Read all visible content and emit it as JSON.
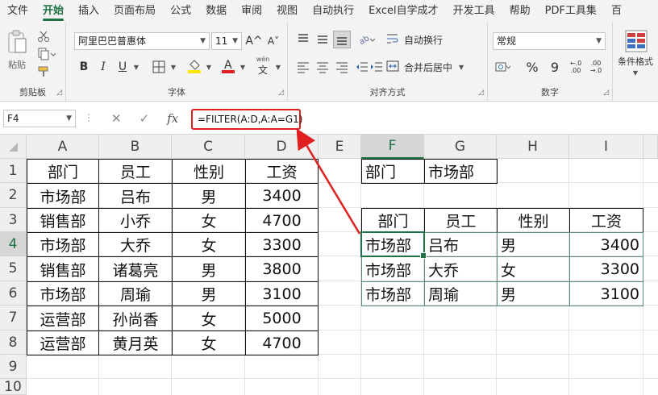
{
  "menu": {
    "tabs": [
      "文件",
      "开始",
      "插入",
      "页面布局",
      "公式",
      "数据",
      "审阅",
      "视图",
      "自动执行",
      "Excel自学成才",
      "开发工具",
      "帮助",
      "PDF工具集",
      "百"
    ],
    "active": "开始"
  },
  "ribbon": {
    "clipboard": {
      "label": "剪贴板",
      "paste": "粘贴"
    },
    "font": {
      "label": "字体",
      "name": "阿里巴巴普惠体",
      "size": "11",
      "grow": "A^",
      "shrink": "A˅",
      "bold": "B",
      "italic": "I",
      "underline": "U",
      "phonetic_top": "wén",
      "phonetic_bottom": "文"
    },
    "alignment": {
      "label": "对齐方式",
      "wrap": "自动换行",
      "merge": "合并后居中"
    },
    "number": {
      "label": "数字",
      "format": "常规",
      "percent": "%",
      "comma": "9",
      "inc": "←.0 .00",
      "dec": ".00 →.0"
    },
    "styles": {
      "conditional": "条件格式"
    }
  },
  "formula_bar": {
    "name_box": "F4",
    "formula": "=FILTER(A:D,A:A=G1)"
  },
  "columns": [
    "A",
    "B",
    "C",
    "D",
    "E",
    "F",
    "G",
    "H",
    "I"
  ],
  "rows": [
    "1",
    "2",
    "3",
    "4",
    "5",
    "6",
    "7",
    "8",
    "9",
    "10"
  ],
  "source_table": {
    "headers": [
      "部门",
      "员工",
      "性别",
      "工资"
    ],
    "rows": [
      [
        "市场部",
        "吕布",
        "男",
        "3400"
      ],
      [
        "销售部",
        "小乔",
        "女",
        "4700"
      ],
      [
        "市场部",
        "大乔",
        "女",
        "3300"
      ],
      [
        "销售部",
        "诸葛亮",
        "男",
        "3800"
      ],
      [
        "市场部",
        "周瑜",
        "男",
        "3100"
      ],
      [
        "运营部",
        "孙尚香",
        "女",
        "5000"
      ],
      [
        "运营部",
        "黄月英",
        "女",
        "4700"
      ]
    ]
  },
  "criteria": {
    "label": "部门",
    "value": "市场部"
  },
  "result_table": {
    "headers": [
      "部门",
      "员工",
      "性别",
      "工资"
    ],
    "rows": [
      [
        "市场部",
        "吕布",
        "男",
        "3400"
      ],
      [
        "市场部",
        "大乔",
        "女",
        "3300"
      ],
      [
        "市场部",
        "周瑜",
        "男",
        "3100"
      ]
    ]
  },
  "colors": {
    "accent": "#1e7145",
    "highlight": "#e02020"
  }
}
